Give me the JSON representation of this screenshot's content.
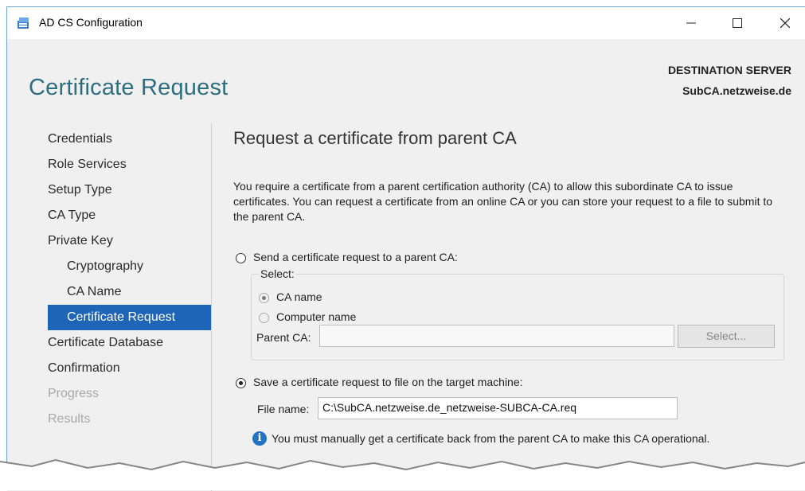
{
  "window": {
    "title": "AD CS Configuration",
    "controls": {
      "minimize": "—",
      "maximize": "☐",
      "close": "✕"
    }
  },
  "header": {
    "page_title": "Certificate Request",
    "destination_label": "DESTINATION SERVER",
    "destination_server": "SubCA.netzweise.de"
  },
  "sidebar": {
    "items": [
      {
        "label": "Credentials",
        "state": "normal"
      },
      {
        "label": "Role Services",
        "state": "normal"
      },
      {
        "label": "Setup Type",
        "state": "normal"
      },
      {
        "label": "CA Type",
        "state": "normal"
      },
      {
        "label": "Private Key",
        "state": "normal"
      },
      {
        "label": "Cryptography",
        "state": "sub"
      },
      {
        "label": "CA Name",
        "state": "sub"
      },
      {
        "label": "Certificate Request",
        "state": "active"
      },
      {
        "label": "Certificate Database",
        "state": "normal"
      },
      {
        "label": "Confirmation",
        "state": "normal"
      },
      {
        "label": "Progress",
        "state": "disabled"
      },
      {
        "label": "Results",
        "state": "disabled"
      }
    ]
  },
  "main": {
    "section_title": "Request a certificate from parent CA",
    "description": "You require a certificate from a parent certification authority (CA) to allow this subordinate CA to issue certificates. You can request a certificate from an online CA or you can store your request to a file to submit to the parent CA.",
    "option_send": {
      "label": "Send a certificate request to a parent CA:",
      "selected": false
    },
    "select_group": {
      "legend": "Select:",
      "ca_name": {
        "label": "CA name",
        "selected": true
      },
      "computer_name": {
        "label": "Computer name",
        "selected": false
      },
      "parent_ca_label": "Parent CA:",
      "parent_ca_value": "",
      "select_button": "Select..."
    },
    "option_save": {
      "label": "Save a certificate request to file on the target machine:",
      "selected": true
    },
    "file_name_label": "File name:",
    "file_name_value": "C:\\SubCA.netzweise.de_netzweise-SUBCA-CA.req",
    "info_text": "You must manually get a certificate back from the parent CA to make this CA operational."
  },
  "colors": {
    "accent": "#1e64b7",
    "title_teal": "#2d6e80",
    "info_blue": "#2273c4"
  }
}
